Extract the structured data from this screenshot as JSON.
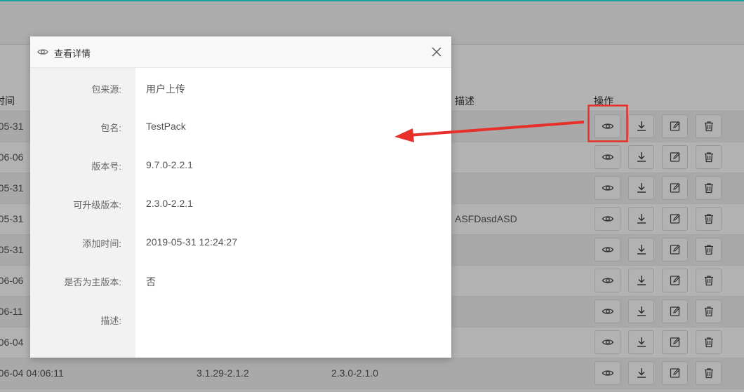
{
  "table": {
    "headers": {
      "time": "时间",
      "desc": "描述",
      "ops": "操作"
    },
    "rows": [
      {
        "time": "-05-31",
        "version": "",
        "upgrade": "",
        "desc": ""
      },
      {
        "time": "-06-06",
        "version": "",
        "upgrade": "",
        "desc": ""
      },
      {
        "time": "-05-31",
        "version": "",
        "upgrade": "",
        "desc": ""
      },
      {
        "time": "-05-31",
        "version": "",
        "upgrade": "",
        "desc": "ASFDasdASD"
      },
      {
        "time": "-05-31",
        "version": "",
        "upgrade": "",
        "desc": ""
      },
      {
        "time": "-06-06",
        "version": "",
        "upgrade": "",
        "desc": ""
      },
      {
        "time": "-06-11",
        "version": "",
        "upgrade": "",
        "desc": ""
      },
      {
        "time": "-06-04",
        "version": "",
        "upgrade": "",
        "desc": ""
      },
      {
        "time": "-06-04 04:06:11",
        "version": "3.1.29-2.1.2",
        "upgrade": "2.3.0-2.1.0",
        "desc": ""
      }
    ]
  },
  "icons": {
    "view": "eye-icon",
    "download": "download-icon",
    "edit": "edit-icon",
    "delete": "trash-icon"
  },
  "modal": {
    "title": "查看详情",
    "fields": [
      {
        "label": "包来源:",
        "value": "用户上传"
      },
      {
        "label": "包名:",
        "value": "TestPack"
      },
      {
        "label": "版本号:",
        "value": "9.7.0-2.2.1"
      },
      {
        "label": "可升级版本:",
        "value": "2.3.0-2.2.1"
      },
      {
        "label": "添加时间:",
        "value": "2019-05-31 12:24:27"
      },
      {
        "label": "是否为主版本:",
        "value": "否"
      },
      {
        "label": "描述:",
        "value": ""
      }
    ]
  },
  "colors": {
    "accent": "#16a39a",
    "annotation": "#e8302a"
  }
}
